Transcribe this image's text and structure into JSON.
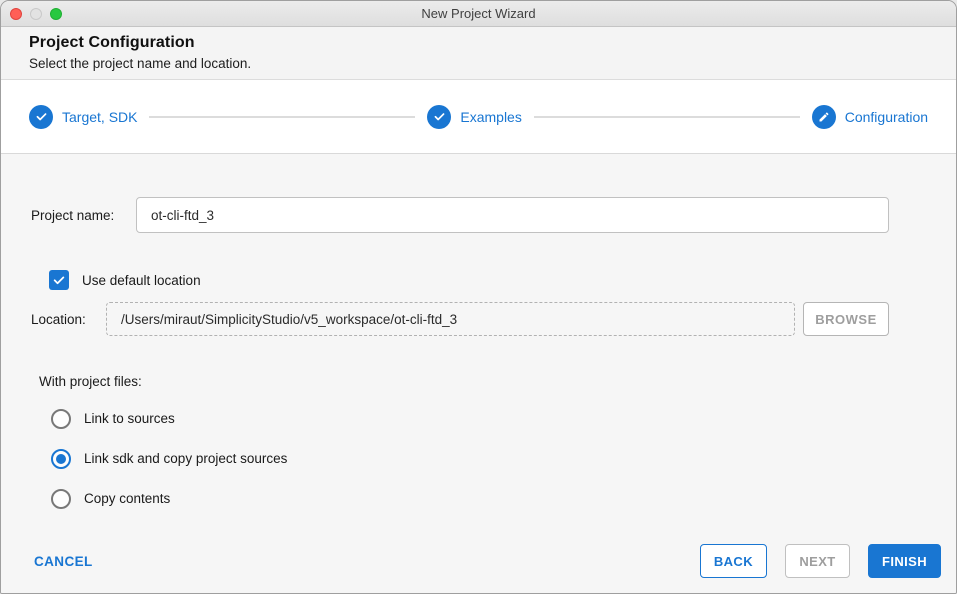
{
  "window": {
    "title": "New Project Wizard",
    "traffic_lights": [
      "close",
      "minimize",
      "zoom"
    ]
  },
  "header": {
    "title": "Project Configuration",
    "subtitle": "Select the project name and location."
  },
  "stepper": {
    "steps": [
      {
        "label": "Target, SDK",
        "state": "completed",
        "icon": "check-icon"
      },
      {
        "label": "Examples",
        "state": "completed",
        "icon": "check-icon"
      },
      {
        "label": "Configuration",
        "state": "current",
        "icon": "pencil-icon"
      }
    ]
  },
  "form": {
    "project_name": {
      "label": "Project name:",
      "value": "ot-cli-ftd_3"
    },
    "use_default_location": {
      "label": "Use default location",
      "checked": true
    },
    "location": {
      "label": "Location:",
      "value": "/Users/miraut/SimplicityStudio/v5_workspace/ot-cli-ftd_3",
      "browse_label": "BROWSE",
      "browse_disabled": true
    },
    "with_project_files": {
      "label": "With project files:",
      "options": [
        {
          "label": "Link to sources",
          "selected": false
        },
        {
          "label": "Link sdk and copy project sources",
          "selected": true
        },
        {
          "label": "Copy contents",
          "selected": false
        }
      ]
    }
  },
  "footer": {
    "cancel_label": "CANCEL",
    "back_label": "BACK",
    "next_label": "NEXT",
    "next_disabled": true,
    "finish_label": "FINISH"
  },
  "colors": {
    "accent": "#1976d2",
    "disabled_text": "#9e9e9e",
    "content_bg": "#f6f6f6"
  }
}
